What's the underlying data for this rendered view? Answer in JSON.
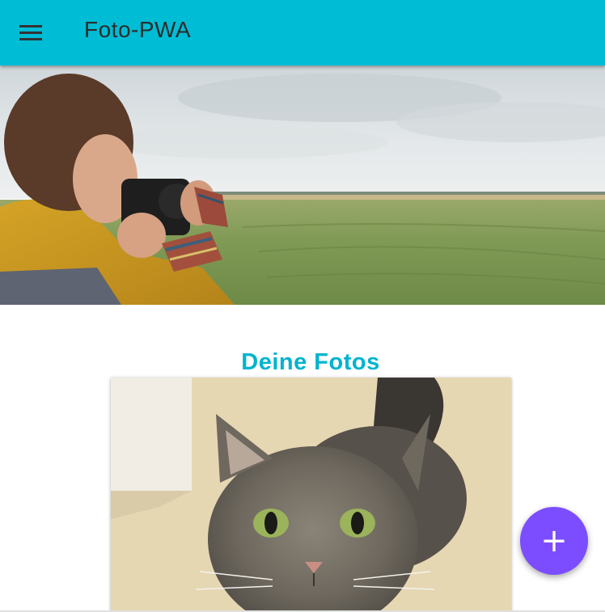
{
  "app": {
    "title": "Foto-PWA",
    "accent_color": "#00bcd4",
    "fab_color": "#7c4dff"
  },
  "header": {
    "menu_icon": "menu-icon",
    "title": "Foto-PWA"
  },
  "hero": {
    "image": "photographer-with-camera-in-field"
  },
  "main": {
    "section_title": "Deine Fotos",
    "photos": [
      {
        "image": "grey-long-haired-cat"
      }
    ]
  },
  "fab": {
    "icon": "plus-icon",
    "glyph": "+"
  }
}
